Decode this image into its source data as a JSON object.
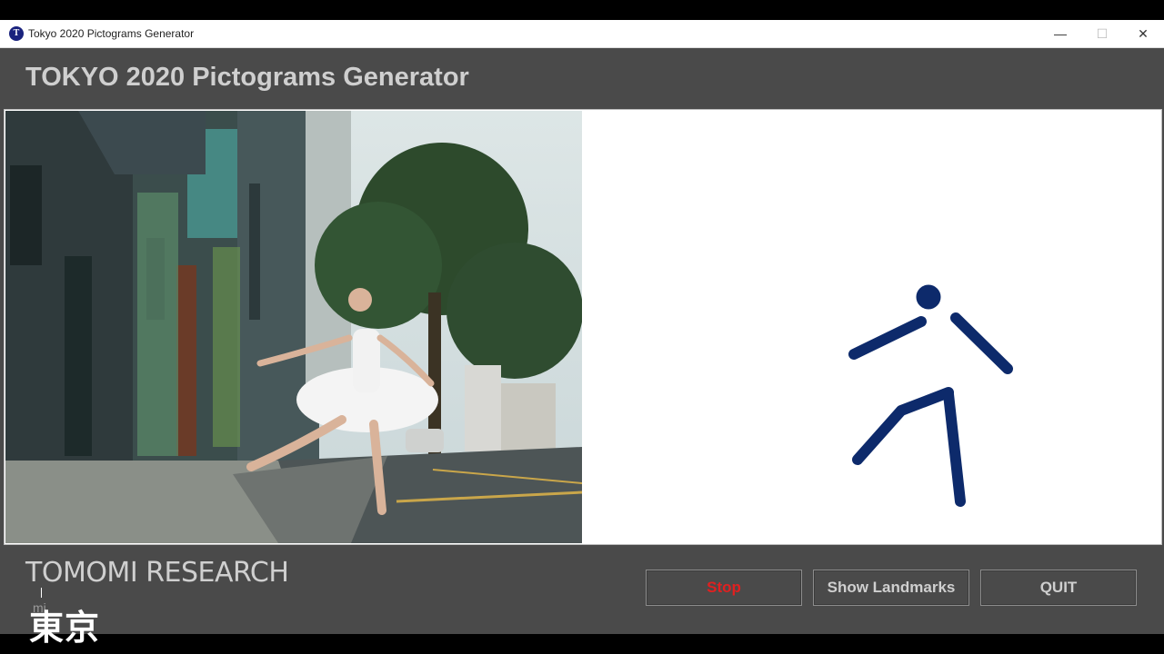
{
  "window": {
    "title": "Tokyo 2020 Pictograms Generator",
    "icon_letter": "T",
    "controls": {
      "minimize": "—",
      "maximize": "☐",
      "close": "✕"
    }
  },
  "app": {
    "heading": "TOKYO 2020 Pictograms Generator",
    "brand": "TOMOMI RESEARCH",
    "sub_caption": "mi"
  },
  "buttons": {
    "stop": "Stop",
    "show_landmarks": "Show Landmarks",
    "quit": "QUIT"
  },
  "overlay": {
    "kanji": "東京"
  },
  "colors": {
    "pictogram": "#0d2a6b",
    "stop_text": "#e02020",
    "panel_bg": "#4a4a4a",
    "text_light": "#cfcfcf"
  },
  "icons": [
    "app-icon",
    "minimize-icon",
    "maximize-icon",
    "close-icon",
    "pictogram-figure"
  ]
}
